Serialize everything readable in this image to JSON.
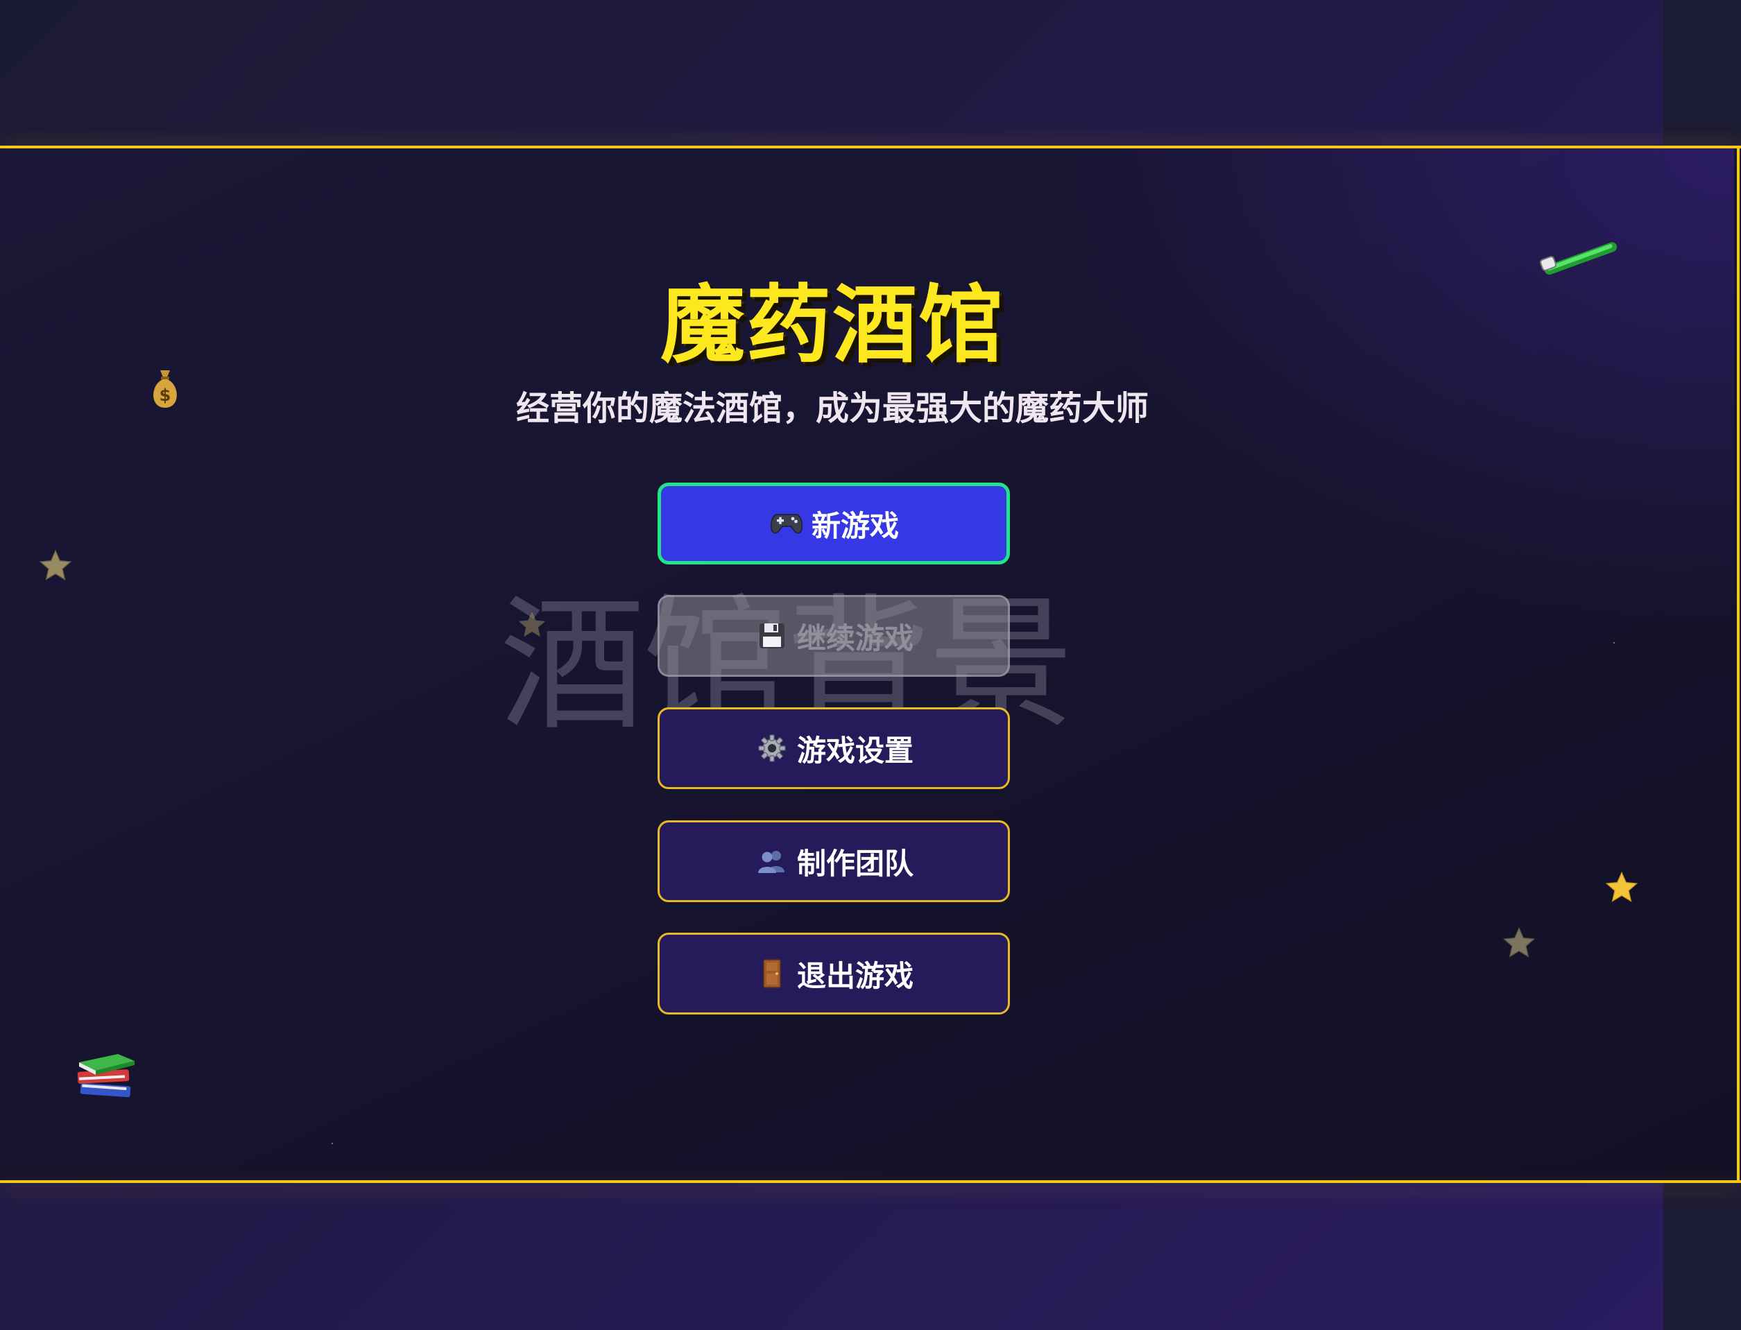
{
  "game": {
    "title": "魔药酒馆",
    "subtitle": "经营你的魔法酒馆，成为最强大的魔药大师",
    "background_placeholder": "酒馆背景"
  },
  "menu": {
    "new_game": {
      "label": "新游戏",
      "icon": "gamepad-icon"
    },
    "continue_game": {
      "label": "继续游戏",
      "icon": "floppy-disk-icon",
      "disabled": true
    },
    "settings": {
      "label": "游戏设置",
      "icon": "gear-icon"
    },
    "credits": {
      "label": "制作团队",
      "icon": "people-icon"
    },
    "exit": {
      "label": "退出游戏",
      "icon": "door-icon"
    }
  },
  "decorations": [
    "money-bag-icon",
    "magic-wand-icon",
    "books-icon",
    "star-icon"
  ],
  "colors": {
    "accent_gold": "#f6c81a",
    "title_yellow": "#fde71e",
    "primary_button": "#3538e4",
    "primary_border": "#20e38a",
    "outline_button_bg": "#261b5a",
    "outline_button_border": "#e8b923"
  }
}
